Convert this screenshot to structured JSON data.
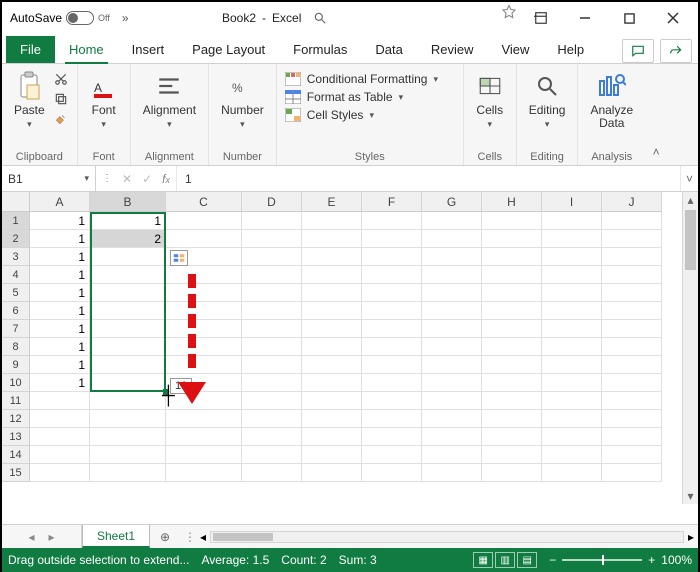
{
  "title": {
    "autosave_label": "AutoSave",
    "autosave_state": "Off",
    "doc": "Book2",
    "app": "Excel",
    "search_icon": "search"
  },
  "tabs": {
    "file": "File",
    "home": "Home",
    "insert": "Insert",
    "page_layout": "Page Layout",
    "formulas": "Formulas",
    "data": "Data",
    "review": "Review",
    "view": "View",
    "help": "Help"
  },
  "ribbon": {
    "clipboard": {
      "paste": "Paste",
      "label": "Clipboard"
    },
    "font": {
      "btn": "Font",
      "label": "Font"
    },
    "alignment": {
      "btn": "Alignment",
      "label": "Alignment"
    },
    "number": {
      "btn": "Number",
      "label": "Number"
    },
    "styles": {
      "cond": "Conditional Formatting",
      "table": "Format as Table",
      "cell": "Cell Styles",
      "label": "Styles"
    },
    "cells": {
      "btn": "Cells",
      "label": "Cells"
    },
    "editing": {
      "btn": "Editing",
      "label": "Editing"
    },
    "analysis": {
      "btn": "Analyze\nData",
      "label": "Analysis"
    }
  },
  "fx": {
    "namebox": "B1",
    "formula": "1"
  },
  "grid": {
    "cols": [
      "A",
      "B",
      "C",
      "D",
      "E",
      "F",
      "G",
      "H",
      "I",
      "J"
    ],
    "rows": [
      "1",
      "2",
      "3",
      "4",
      "5",
      "6",
      "7",
      "8",
      "9",
      "10",
      "11",
      "12",
      "13",
      "14",
      "15"
    ],
    "colA": [
      "1",
      "1",
      "1",
      "1",
      "1",
      "1",
      "1",
      "1",
      "1",
      "1",
      "",
      "",
      "",
      "",
      ""
    ],
    "colB": [
      "1",
      "2",
      "",
      "",
      "",
      "",
      "",
      "",
      "",
      "",
      "",
      "",
      "",
      "",
      ""
    ],
    "tooltip": "10"
  },
  "sheet": {
    "tab": "Sheet1"
  },
  "status": {
    "msg": "Drag outside selection to extend...",
    "avg": "Average: 1.5",
    "count": "Count: 2",
    "sum": "Sum: 3",
    "zoom": "100%"
  }
}
